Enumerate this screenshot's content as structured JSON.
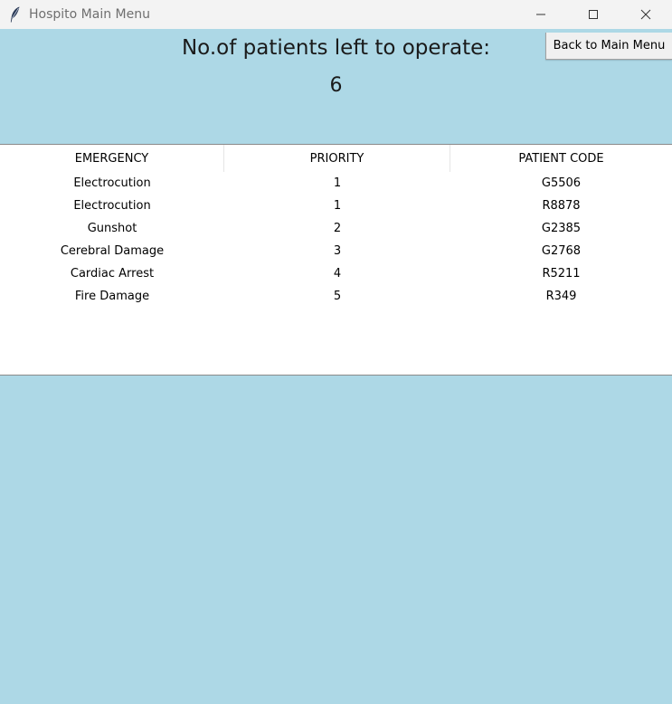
{
  "window": {
    "title": "Hospito Main Menu",
    "app_icon": "feather-icon",
    "controls": [
      "minimize-icon",
      "maximize-icon",
      "close-icon"
    ],
    "background": "#ADD8E6"
  },
  "header": {
    "title": "No.of patients left to operate:",
    "count": "6",
    "back_button_label": "Back to Main Menu"
  },
  "table": {
    "columns": [
      "EMERGENCY",
      "PRIORITY",
      "PATIENT CODE"
    ],
    "rows": [
      {
        "emergency": "Electrocution",
        "priority": "1",
        "code": "G5506"
      },
      {
        "emergency": "Electrocution",
        "priority": "1",
        "code": "R8878"
      },
      {
        "emergency": "Gunshot",
        "priority": "2",
        "code": "G2385"
      },
      {
        "emergency": "Cerebral Damage",
        "priority": "3",
        "code": "G2768"
      },
      {
        "emergency": "Cardiac Arrest",
        "priority": "4",
        "code": "R5211"
      },
      {
        "emergency": "Fire Damage",
        "priority": "5",
        "code": "R349"
      }
    ]
  }
}
